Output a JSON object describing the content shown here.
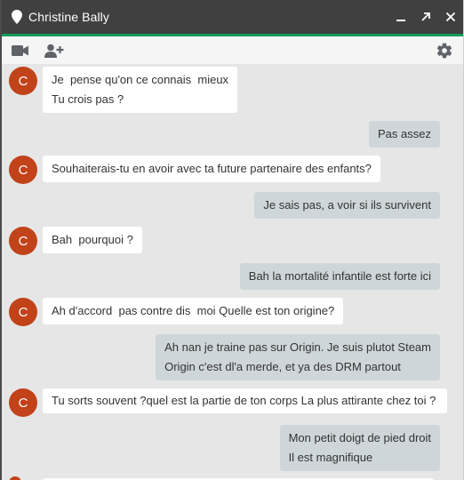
{
  "window": {
    "title": "Christine Bally",
    "colors": {
      "titlebar": "#404040",
      "accent": "#0f9d58",
      "avatar": "#c2421a",
      "outgoing_bubble": "#cfd6d9",
      "incoming_bubble": "#ffffff"
    }
  },
  "controls": {
    "minimize": "▁",
    "popout": "↗",
    "close": "✕"
  },
  "toolbar": {
    "icons": [
      "video-camera-icon",
      "add-person-icon",
      "gear-icon"
    ]
  },
  "messages": [
    {
      "from": "in",
      "avatar": "C",
      "lines": [
        "Je  pense qu'on ce connais  mieux",
        "Tu crois pas ?"
      ]
    },
    {
      "from": "out",
      "lines": [
        "Pas assez"
      ]
    },
    {
      "from": "in",
      "avatar": "C",
      "lines": [
        "Souhaiterais-tu en avoir avec ta future partenaire des enfants?"
      ]
    },
    {
      "from": "out",
      "lines": [
        "Je sais pas, a voir si ils survivent"
      ]
    },
    {
      "from": "in",
      "avatar": "C",
      "lines": [
        "Bah  pourquoi ?"
      ]
    },
    {
      "from": "out",
      "lines": [
        "Bah la mortalité infantile est forte ici"
      ]
    },
    {
      "from": "in",
      "avatar": "C",
      "lines": [
        "Ah d'accord  pas contre dis  moi Quelle est ton origine?"
      ]
    },
    {
      "from": "out",
      "lines": [
        "Ah nan je traine pas sur Origin. Je suis plutot Steam",
        "Origin c'est dl'a merde, et ya des DRM partout"
      ]
    },
    {
      "from": "in",
      "avatar": "C",
      "wrap": true,
      "lines": [
        "Tu sorts souvent ?quel est la partie de ton corps La plus attirante chez toi ?"
      ]
    },
    {
      "from": "out",
      "lines": [
        "Mon petit doigt de pied droit",
        "Il est magnifique"
      ]
    }
  ]
}
